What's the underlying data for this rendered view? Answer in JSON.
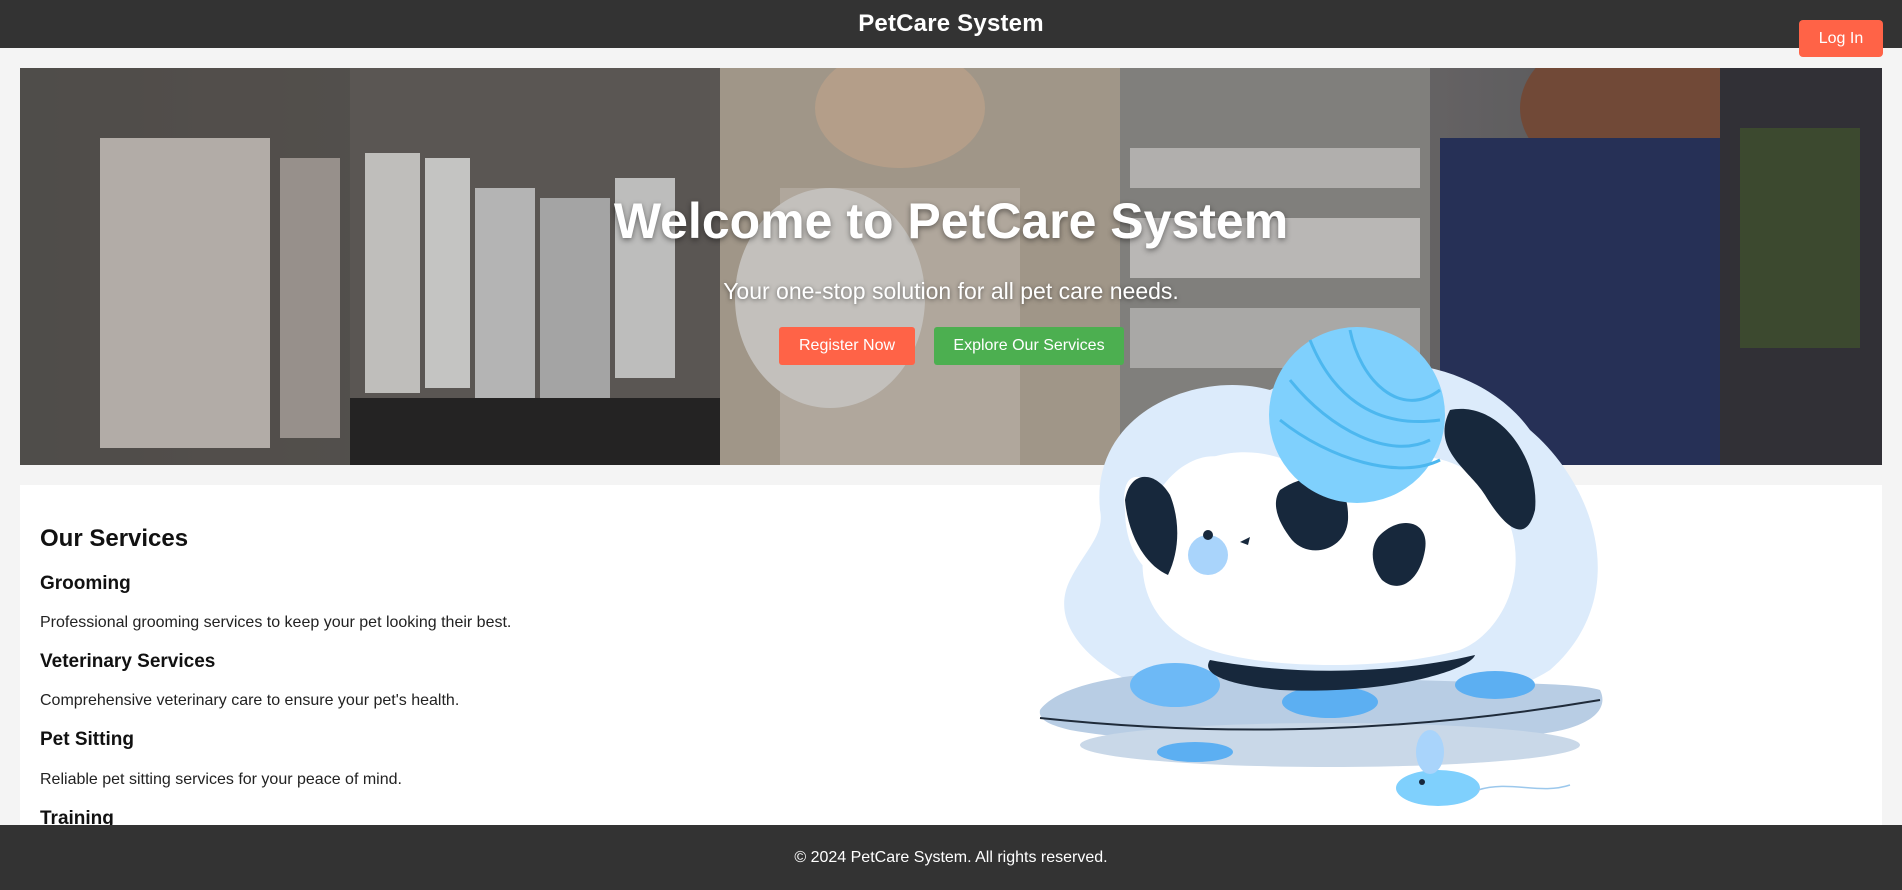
{
  "header": {
    "title": "PetCare System",
    "login_label": "Log In"
  },
  "hero": {
    "title": "Welcome to PetCare System",
    "subtitle": "Your one-stop solution for all pet care needs.",
    "register_label": "Register Now",
    "explore_label": "Explore Our Services"
  },
  "services": {
    "heading": "Our Services",
    "items": [
      {
        "title": "Grooming",
        "description": "Professional grooming services to keep your pet looking their best."
      },
      {
        "title": "Veterinary Services",
        "description": "Comprehensive veterinary care to ensure your pet's health."
      },
      {
        "title": "Pet Sitting",
        "description": "Reliable pet sitting services for your peace of mind."
      },
      {
        "title": "Training",
        "description": ""
      }
    ]
  },
  "footer": {
    "text": "© 2024 PetCare System. All rights reserved."
  },
  "colors": {
    "dark_bar": "#333333",
    "accent_red": "#ff6347",
    "accent_green": "#4caf50"
  }
}
